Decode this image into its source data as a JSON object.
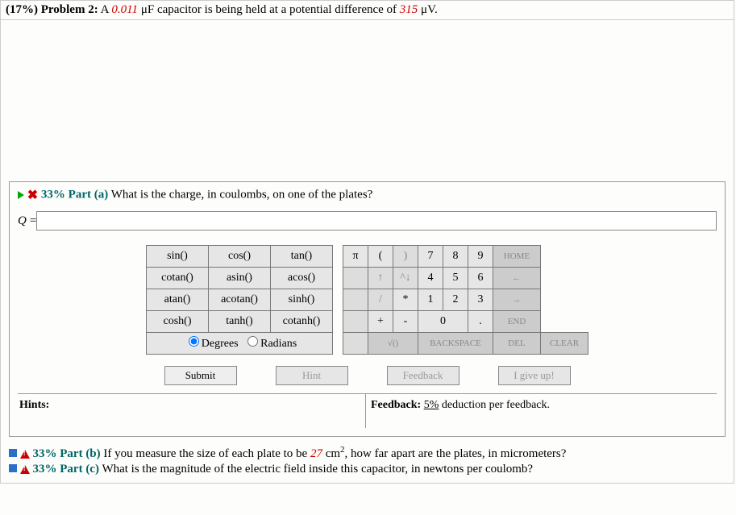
{
  "header": {
    "percent": "(17%)",
    "problem": "Problem 2:",
    "text_a": "A ",
    "val1": "0.011",
    "unit1": " μF capacitor is being held at a potential difference of ",
    "val2": "315",
    "unit2": " μV."
  },
  "partA": {
    "label": "33% Part (a)",
    "question": " What is the charge, in coulombs, on one of the plates?",
    "var": "Q",
    "equals": " = ",
    "input_value": ""
  },
  "calc": {
    "fn": [
      [
        "sin()",
        "cos()",
        "tan()"
      ],
      [
        "cotan()",
        "asin()",
        "acos()"
      ],
      [
        "atan()",
        "acotan()",
        "sinh()"
      ],
      [
        "cosh()",
        "tanh()",
        "cotanh()"
      ]
    ],
    "deg_label": "Degrees",
    "rad_label": "Radians",
    "num": {
      "r1": [
        "π",
        "(",
        ")",
        "7",
        "8",
        "9",
        "HOME"
      ],
      "r2": [
        "",
        "↑",
        "^↓",
        "4",
        "5",
        "6",
        "←"
      ],
      "r3": [
        "",
        "/",
        "*",
        "1",
        "2",
        "3",
        "→"
      ],
      "r4": [
        "",
        "+",
        "-",
        "0",
        ".",
        "END"
      ],
      "r5": [
        "",
        "√()",
        "BACKSPACE",
        "DEL",
        "CLEAR"
      ]
    }
  },
  "buttons": {
    "submit": "Submit",
    "hint": "Hint",
    "feedback": "Feedback",
    "giveup": "I give up!"
  },
  "hints": {
    "left_label": "Hints:",
    "right_label": "Feedback: ",
    "right_pct": "5%",
    "right_rest": " deduction per feedback."
  },
  "partB": {
    "label": "33% Part (b)",
    "text_a": " If you measure the size of each plate to be ",
    "val": "27",
    "text_b": " cm",
    "sup": "2",
    "text_c": ", how far apart are the plates, in micrometers?"
  },
  "partC": {
    "label": "33% Part (c)",
    "question": " What is the magnitude of the electric field inside this capacitor, in newtons per coulomb?"
  }
}
